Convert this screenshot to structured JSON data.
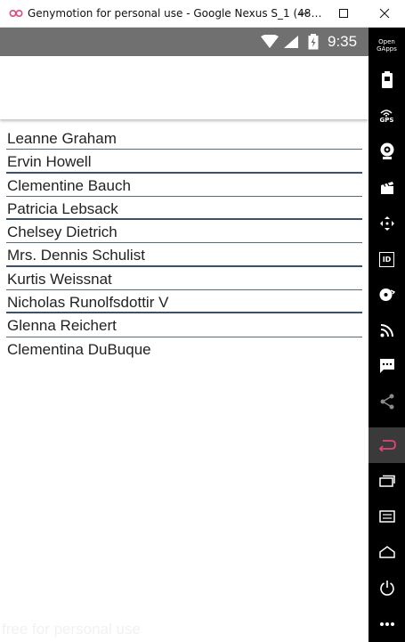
{
  "window": {
    "title": "Genymotion for personal use - Google Nexus S_1 (48…"
  },
  "status_bar": {
    "time": "9:35"
  },
  "list": {
    "items": [
      {
        "label": "Leanne Graham"
      },
      {
        "label": "Ervin Howell"
      },
      {
        "label": "Clementine Bauch"
      },
      {
        "label": "Patricia Lebsack"
      },
      {
        "label": "Chelsey Dietrich"
      },
      {
        "label": "Mrs. Dennis Schulist"
      },
      {
        "label": "Kurtis Weissnat"
      },
      {
        "label": "Nicholas Runolfsdottir V"
      },
      {
        "label": "Glenna Reichert"
      },
      {
        "label": "Clementina DuBuque"
      }
    ]
  },
  "sidebar": {
    "open_gapps_line1": "Open",
    "open_gapps_line2": "GApps",
    "gps_label": "GPS",
    "id_label": "ID"
  },
  "watermark": "free for personal use",
  "colors": {
    "status_bar": "#707070",
    "sidebar_bg": "#000000",
    "back_active": "#e0457b",
    "separator": "#5a6a7c"
  }
}
